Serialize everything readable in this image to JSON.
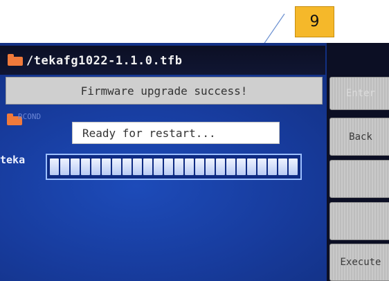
{
  "callout": {
    "label": "9"
  },
  "dialog": {
    "path": "/tekafg1022-1.1.0.tfb",
    "status_message": "Firmware upgrade success!",
    "restart_message": "Ready for restart...",
    "list_row_text": "RCOND",
    "file_label": "teka",
    "progress_percent": 100,
    "progress_segments": 24
  },
  "side_buttons": [
    {
      "label": "Enter",
      "enabled": false
    },
    {
      "label": "Back",
      "enabled": true
    },
    {
      "label": "",
      "enabled": false
    },
    {
      "label": "",
      "enabled": false
    },
    {
      "label": "Execute",
      "enabled": true
    }
  ],
  "colors": {
    "screen_blue": "#173b9c",
    "folder_orange": "#f07a3b",
    "callout_yellow": "#f5b82a"
  }
}
